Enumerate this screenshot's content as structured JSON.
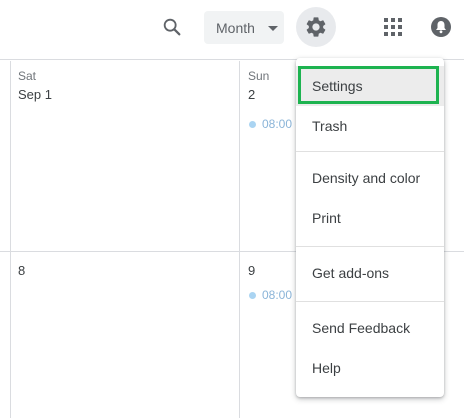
{
  "header": {
    "view_selector": {
      "value": "Month"
    }
  },
  "icons": {
    "search": "search-icon",
    "settings": "gear-icon",
    "apps": "apps-grid-icon",
    "account": "account-icon",
    "dropdown": "chevron-down-icon"
  },
  "calendar": {
    "week1": {
      "sat": {
        "day_name": "Sat",
        "date": "Sep 1"
      },
      "sun": {
        "day_name": "Sun",
        "date": "2",
        "event_time": "08:00"
      }
    },
    "week2": {
      "sat": {
        "date": "8"
      },
      "sun": {
        "date": "9",
        "event_time": "08:00"
      }
    }
  },
  "settings_menu": {
    "items": [
      {
        "label": "Settings"
      },
      {
        "label": "Trash"
      },
      {
        "label": "Density and color"
      },
      {
        "label": "Print"
      },
      {
        "label": "Get add-ons"
      },
      {
        "label": "Send Feedback"
      },
      {
        "label": "Help"
      }
    ]
  },
  "colors": {
    "highlight": "#1db350",
    "event_dot": "#aad4f2",
    "gridline": "#dadce0"
  }
}
